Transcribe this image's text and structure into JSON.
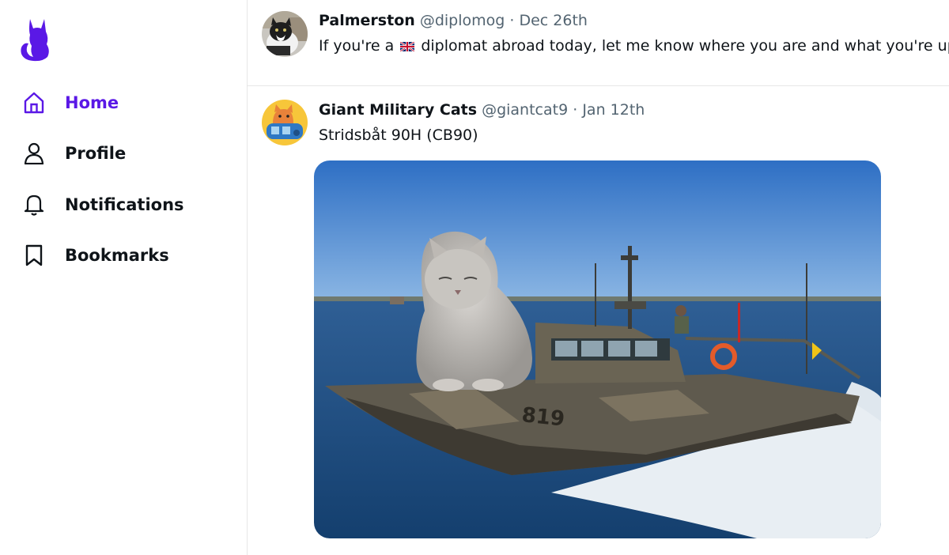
{
  "app": {
    "brand_color": "#5a18e6",
    "logo_icon": "cat-silhouette-icon"
  },
  "sidebar": {
    "items": [
      {
        "label": "Home",
        "icon": "home-icon",
        "active": true
      },
      {
        "label": "Profile",
        "icon": "user-icon",
        "active": false
      },
      {
        "label": "Notifications",
        "icon": "bell-icon",
        "active": false
      },
      {
        "label": "Bookmarks",
        "icon": "bookmark-icon",
        "active": false
      }
    ]
  },
  "feed": {
    "posts": [
      {
        "name": "Palmerston",
        "handle": "@diplomog",
        "separator": "·",
        "date": "Dec 26th",
        "text_before": "If you're a",
        "text_after": "diplomat abroad today, let me know where you are and what you're up to!",
        "inline_icon": "uk-flag-icon"
      },
      {
        "name": "Giant Military Cats",
        "handle": "@giantcat9",
        "separator": "·",
        "date": "Jan 12th",
        "text": "Stridsbåt 90H (CB90)",
        "media_number": "819"
      }
    ]
  }
}
